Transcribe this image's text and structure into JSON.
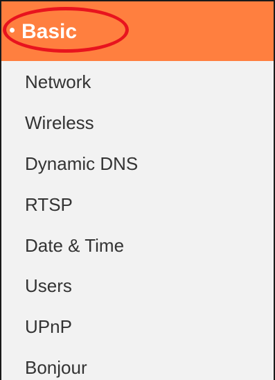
{
  "menu": {
    "active_section": "Basic",
    "items": [
      {
        "label": "Network"
      },
      {
        "label": "Wireless"
      },
      {
        "label": "Dynamic DNS"
      },
      {
        "label": "RTSP"
      },
      {
        "label": "Date & Time"
      },
      {
        "label": "Users"
      },
      {
        "label": "UPnP"
      },
      {
        "label": "Bonjour"
      }
    ]
  },
  "colors": {
    "header_bg": "#ff7f3f",
    "menu_bg": "#f2f2f2",
    "highlight_ring": "#e8141e"
  }
}
